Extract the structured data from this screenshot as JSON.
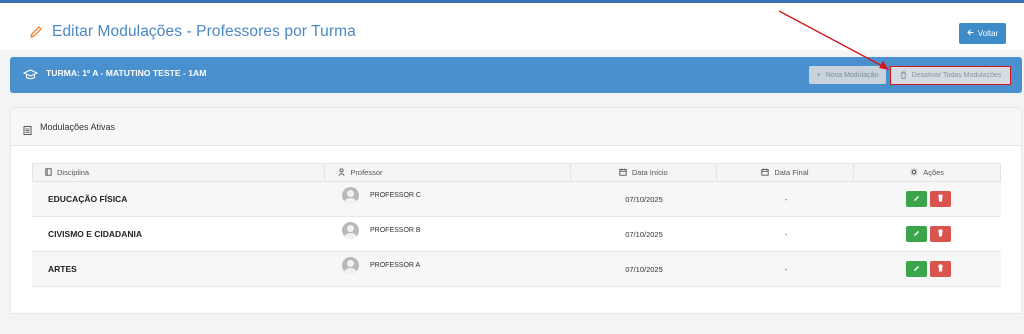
{
  "header": {
    "title": "Editar Modulações - Professores por Turma",
    "back_label": "Voltar"
  },
  "turma": {
    "label": "TURMA: 1º A - MATUTINO TESTE - 1AM",
    "nova_label": "Nova Modulação",
    "desativar_label": "Desativar Todas Modulações"
  },
  "card": {
    "title": "Modulações Ativas"
  },
  "table": {
    "headers": {
      "disciplina": "Disciplina",
      "professor": "Professor",
      "data_inicio": "Data Início",
      "data_final": "Data Final",
      "acoes": "Ações"
    },
    "rows": [
      {
        "disciplina": "EDUCAÇÃO FÍSICA",
        "professor": "PROFESSOR C",
        "data_inicio": "07/10/2025",
        "data_final": "-"
      },
      {
        "disciplina": "CIVISMO E CIDADANIA",
        "professor": "PROFESSOR B",
        "data_inicio": "07/10/2025",
        "data_final": "-"
      },
      {
        "disciplina": "ARTES",
        "professor": "PROFESSOR A",
        "data_inicio": "07/10/2025",
        "data_final": "-"
      }
    ]
  },
  "colors": {
    "primary": "#4a90cf",
    "title": "#4a87c5",
    "edit": "#3aa54a",
    "delete": "#d9534f",
    "annotation": "#d0181e"
  }
}
